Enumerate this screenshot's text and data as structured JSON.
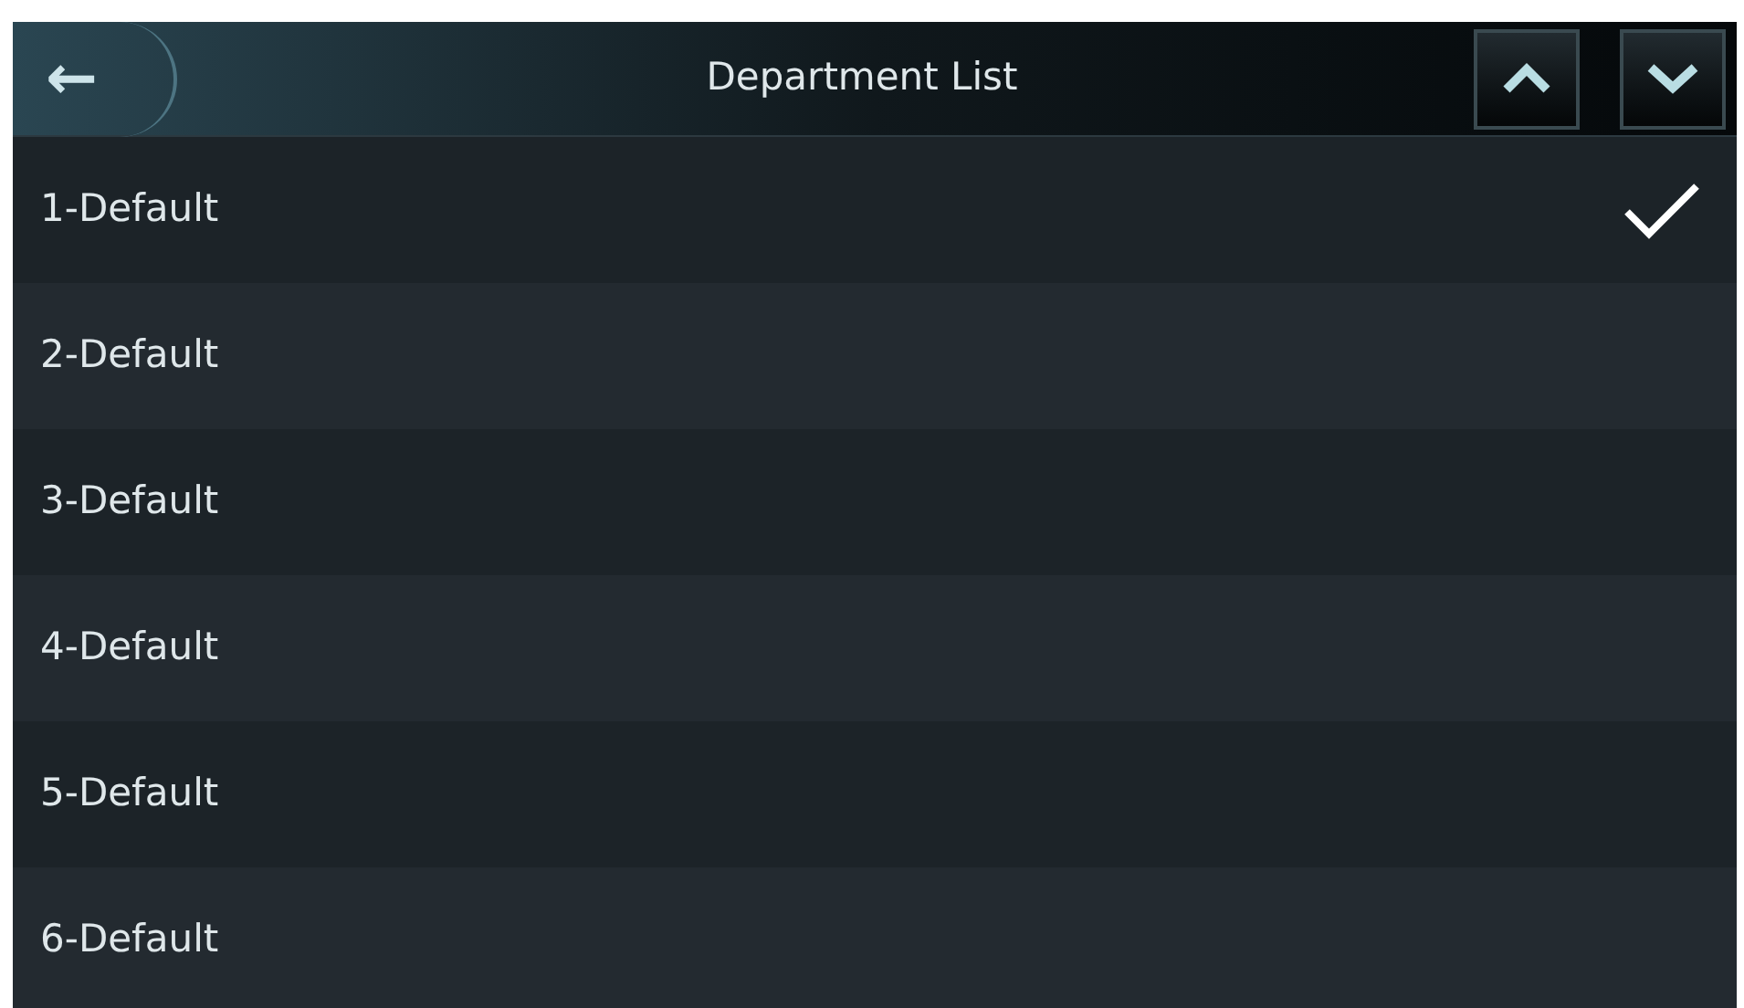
{
  "header": {
    "back": "←",
    "title": "Department List"
  },
  "items": [
    {
      "label": "1-Default",
      "selected": true
    },
    {
      "label": "2-Default",
      "selected": false
    },
    {
      "label": "3-Default",
      "selected": false
    },
    {
      "label": "4-Default",
      "selected": false
    },
    {
      "label": "5-Default",
      "selected": false
    },
    {
      "label": "6-Default",
      "selected": false
    }
  ]
}
